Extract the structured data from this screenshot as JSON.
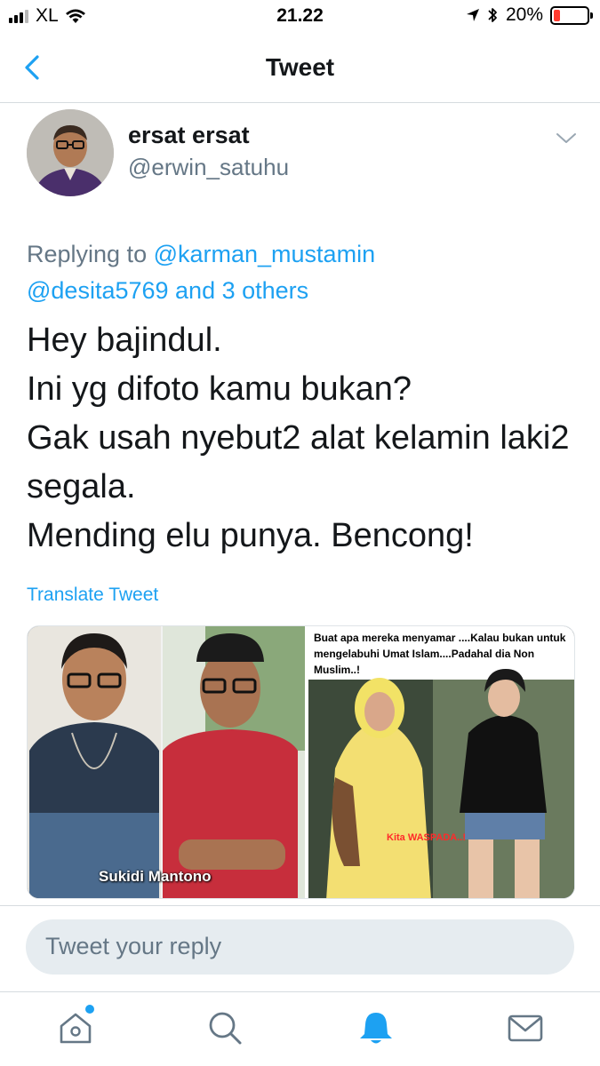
{
  "status_bar": {
    "carrier": "XL",
    "time": "21.22",
    "battery_percent": "20%",
    "battery_level": 0.2,
    "battery_color": "#ff3b30"
  },
  "nav": {
    "title": "Tweet",
    "back_icon": "chevron-left-icon"
  },
  "tweet": {
    "author_name": "ersat ersat",
    "author_handle": "@erwin_satuhu",
    "replying_prefix": "Replying to ",
    "reply_mention_1": "@karman_mustamin",
    "reply_mention_2": "@desita5769",
    "reply_others": " and 3 others",
    "lines": [
      "Hey bajindul.",
      "Ini yg difoto kamu bukan?",
      "Gak usah nyebut2 alat kelamin laki2",
      "segala.",
      "Mending elu punya. Bencong!"
    ],
    "translate_label": "Translate Tweet",
    "media": {
      "left_label": "Sukidi Mantono",
      "right_caption": "Buat apa mereka menyamar ....Kalau bukan untuk mengelabuhi Umat Islam....Padahal dia Non Muslim..!",
      "right_stamp": "Kita WASPADA..!"
    }
  },
  "reply": {
    "placeholder": "Tweet your reply"
  },
  "tabs": [
    "home-icon",
    "search-icon",
    "notifications-icon",
    "messages-icon"
  ],
  "colors": {
    "accent": "#1da1f2",
    "muted": "#657786",
    "text": "#14171a"
  }
}
